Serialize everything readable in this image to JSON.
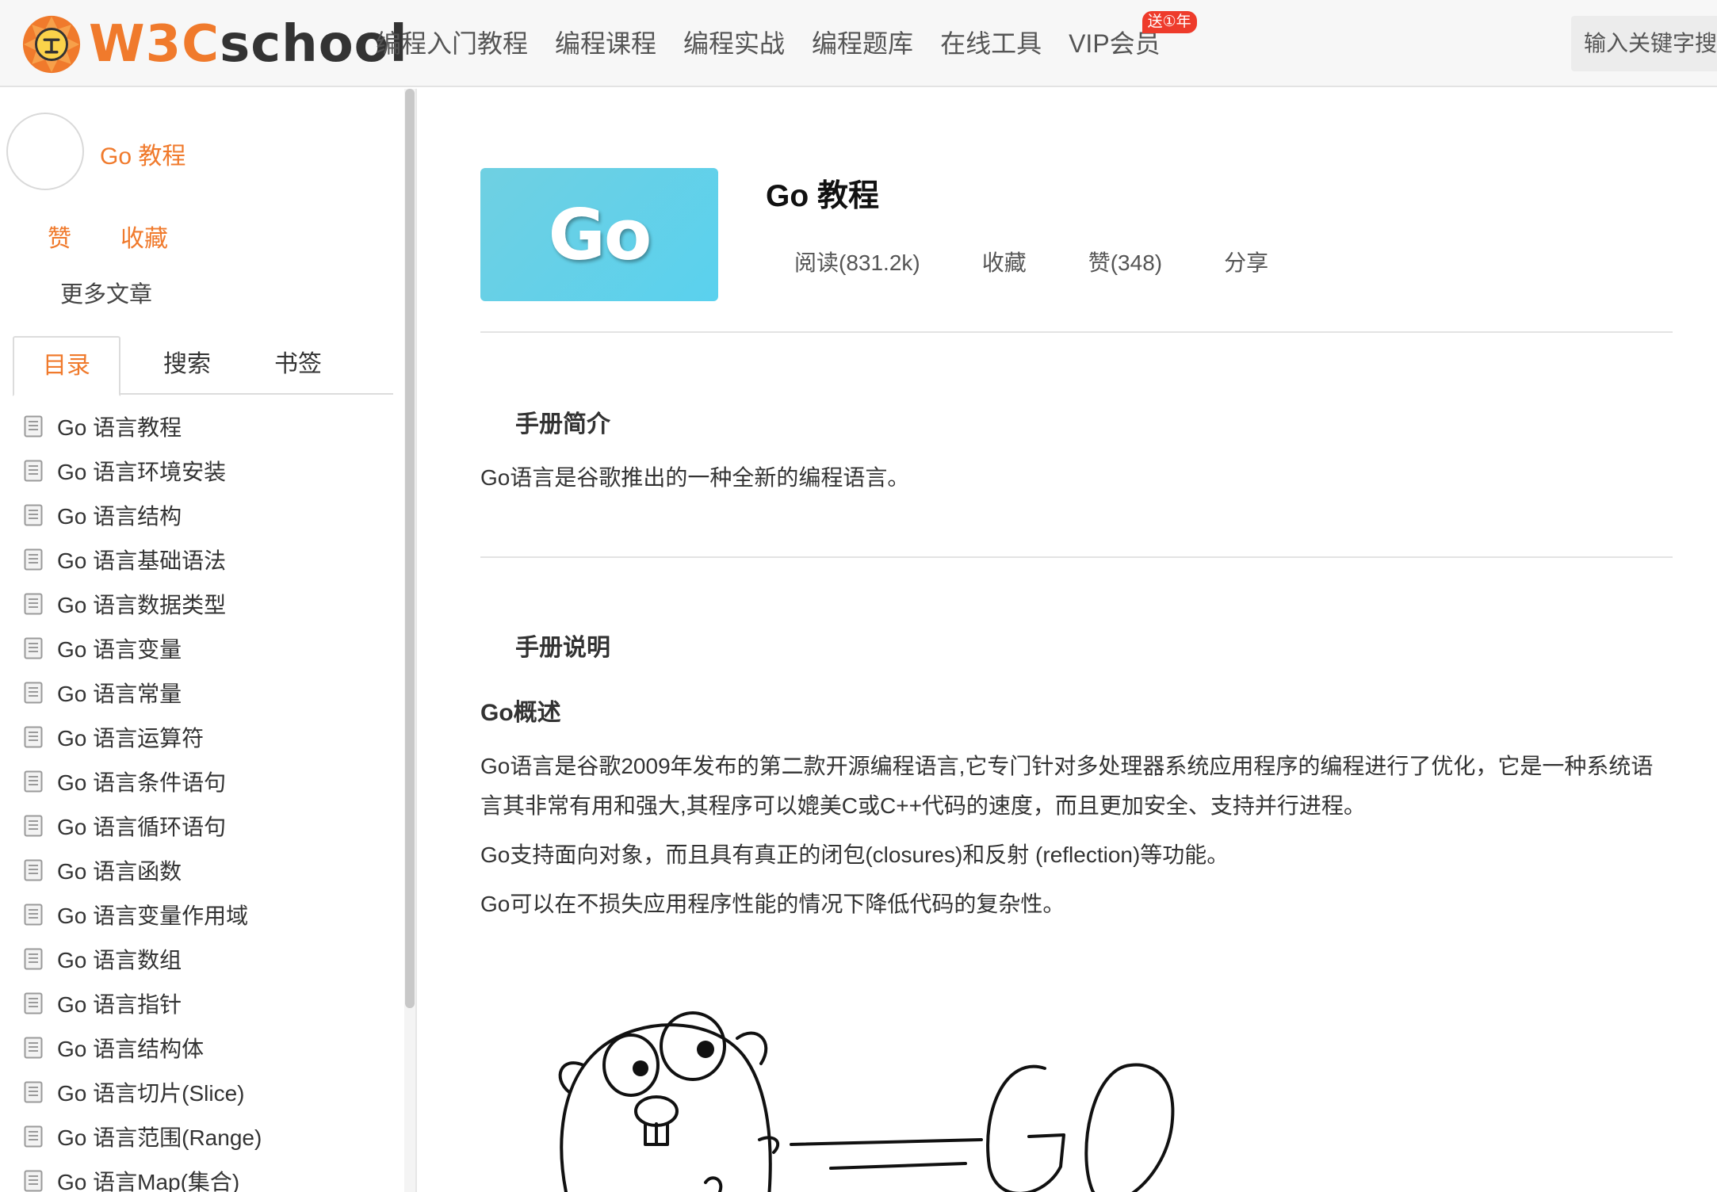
{
  "header": {
    "logo_text_w3c": "W3C",
    "logo_text_school": "school",
    "nav": [
      {
        "label": "编程入门教程"
      },
      {
        "label": "编程课程"
      },
      {
        "label": "编程实战"
      },
      {
        "label": "编程题库"
      },
      {
        "label": "在线工具"
      },
      {
        "label": "VIP会员",
        "badge": "送①年"
      }
    ],
    "search_placeholder": "输入关键字搜"
  },
  "sidebar": {
    "course_title": "Go 教程",
    "like_label": "赞",
    "favorite_label": "收藏",
    "more_articles": "更多文章",
    "tabs": [
      {
        "label": "目录",
        "active": true
      },
      {
        "label": "搜索",
        "active": false
      },
      {
        "label": "书签",
        "active": false
      }
    ],
    "toc": [
      "Go 语言教程",
      "Go 语言环境安装",
      "Go 语言结构",
      "Go 语言基础语法",
      "Go 语言数据类型",
      "Go 语言变量",
      "Go 语言常量",
      "Go 语言运算符",
      "Go 语言条件语句",
      "Go 语言循环语句",
      "Go 语言函数",
      "Go 语言变量作用域",
      "Go 语言数组",
      "Go 语言指针",
      "Go 语言结构体",
      "Go 语言切片(Slice)",
      "Go 语言范围(Range)",
      "Go 语言Map(集合)"
    ]
  },
  "main": {
    "banner_text": "Go",
    "title": "Go 教程",
    "stats": {
      "reads": "阅读(831.2k)",
      "favorite": "收藏",
      "likes": "赞(348)",
      "share": "分享"
    },
    "intro_heading": "手册简介",
    "intro_text": "Go语言是谷歌推出的一种全新的编程语言。",
    "notes_heading": "手册说明",
    "overview_heading": "Go概述",
    "overview_para1": "Go语言是谷歌2009年发布的第二款开源编程语言,它专门针对多处理器系统应用程序的编程进行了优化，它是一种系统语言其非常有用和强大,其程序可以媲美C或C++代码的速度，而且更加安全、支持并行进程。",
    "overview_para2": "Go支持面向对象，而且具有真正的闭包(closures)和反射 (reflection)等功能。",
    "overview_para3": "Go可以在不损失应用程序性能的情况下降低代码的复杂性。"
  },
  "colors": {
    "accent": "#f07a2c",
    "badge": "#ee3b2b",
    "banner": "#5ad1ee"
  }
}
